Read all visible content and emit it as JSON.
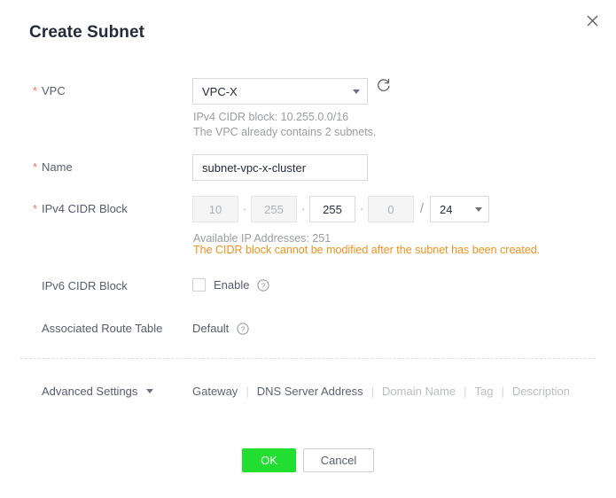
{
  "dialog": {
    "title": "Create Subnet",
    "close_icon": "close-icon"
  },
  "form": {
    "vpc": {
      "label": "VPC",
      "required": true,
      "selected": "VPC-X",
      "refresh_icon": "refresh-icon",
      "hints": [
        "IPv4 CIDR block: 10.255.0.0/16",
        "The VPC already contains 2 subnets."
      ]
    },
    "name": {
      "label": "Name",
      "required": true,
      "value": "subnet-vpc-x-cluster",
      "placeholder": ""
    },
    "ipv4_cidr": {
      "label": "IPv4 CIDR Block",
      "required": true,
      "octets": [
        "10",
        "255",
        "255",
        "0"
      ],
      "octets_disabled": [
        true,
        true,
        false,
        true
      ],
      "separator": "·",
      "slash": "/",
      "mask": "24",
      "available_hint": "Available IP Addresses: 251",
      "warning": "The CIDR block cannot be modified after the subnet has been created."
    },
    "ipv6_cidr": {
      "label": "IPv6 CIDR Block",
      "required": false,
      "checkbox_label": "Enable",
      "checked": false,
      "help_icon": "help-circle-icon"
    },
    "route_table": {
      "label": "Associated Route Table",
      "required": false,
      "value": "Default",
      "help_icon": "help-circle-icon"
    }
  },
  "advanced": {
    "toggle_label": "Advanced Settings",
    "toggle_icon": "chevron-down-icon",
    "links": [
      {
        "label": "Gateway",
        "muted": false
      },
      {
        "label": "DNS Server Address",
        "muted": false
      },
      {
        "label": "Domain Name",
        "muted": true
      },
      {
        "label": "Tag",
        "muted": true
      },
      {
        "label": "Description",
        "muted": true
      }
    ],
    "separator": "|"
  },
  "footer": {
    "ok_label": "OK",
    "cancel_label": "Cancel"
  },
  "colors": {
    "required_asterisk": "#f66f6a",
    "warning": "#f3911e",
    "primary_button": "#21de30",
    "title": "#252b3a",
    "label": "#575d6c",
    "hint": "#999ca3"
  }
}
